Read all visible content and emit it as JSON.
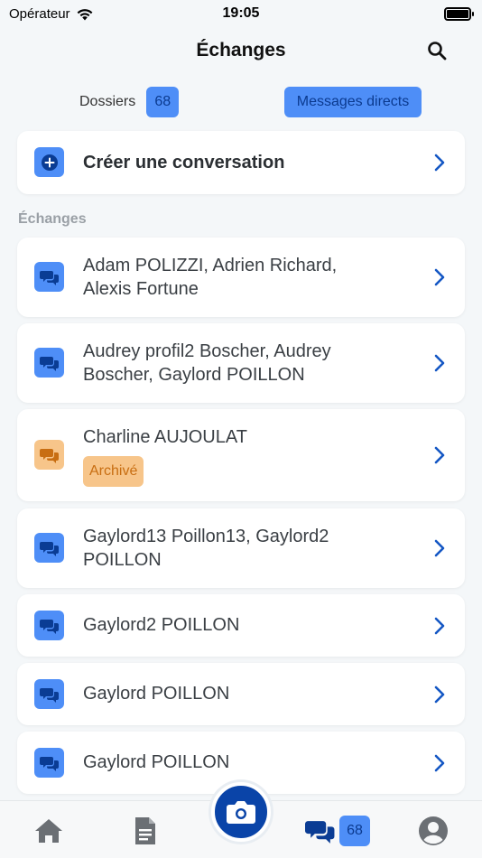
{
  "status_bar": {
    "carrier": "Opérateur",
    "time": "19:05"
  },
  "header": {
    "title": "Échanges"
  },
  "segment": {
    "dossiers_label": "Dossiers",
    "dossiers_count": "68",
    "direct_label": "Messages directs"
  },
  "create": {
    "label": "Créer une conversation"
  },
  "section": {
    "label": "Échanges"
  },
  "conversations": [
    {
      "line1": "Adam POLIZZI, Adrien Richard,",
      "line2": "Alexis Fortune"
    },
    {
      "line1": "Audrey profil2 Boscher, Audrey",
      "line2": "Boscher, Gaylord POILLON"
    },
    {
      "line1": "Charline AUJOULAT",
      "badge": "Archivé"
    },
    {
      "line1": "Gaylord13 Poillon13, Gaylord2",
      "line2": "POILLON"
    },
    {
      "line1": "Gaylord2 POILLON"
    },
    {
      "line1": "Gaylord POILLON"
    },
    {
      "line1": "Gaylord POILLON"
    }
  ],
  "tab_bar": {
    "messages_count": "68"
  },
  "colors": {
    "accent": "#4e8ef7",
    "accent_text": "#0b3a8f",
    "archived_bg": "#f7c58a",
    "archived_text": "#c86e12",
    "fab": "#0a44a8"
  },
  "icons": {
    "search": "search-icon",
    "add": "plus-circle-icon",
    "chat": "chat-bubbles-icon",
    "chevron": "chevron-right-icon",
    "home": "home-icon",
    "document": "document-icon",
    "camera": "camera-icon",
    "profile": "profile-icon"
  }
}
